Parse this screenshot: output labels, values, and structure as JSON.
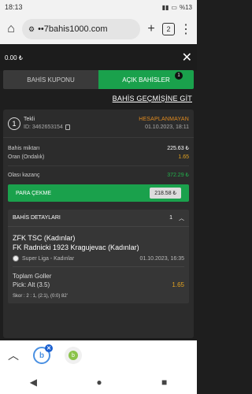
{
  "status": {
    "time": "18:13",
    "battery": "%13"
  },
  "browser": {
    "url": "••7bahis1000.com",
    "tab_count": "2"
  },
  "wallet": {
    "balance": "0.00 ₺"
  },
  "tabs": [
    {
      "label": "BAHİS KUPONU"
    },
    {
      "label": "AÇIK BAHİSLER",
      "badge": "1"
    }
  ],
  "history_link": "BAHİS GEÇMİŞİNE GİT",
  "bet": {
    "number": "1",
    "type": "Tekli",
    "id_label": "ID: 3462653154",
    "status": "HESAPLANMAYAN",
    "date": "01.10.2023, 18:11",
    "stake_label": "Bahis miktarı",
    "stake_value": "225.63 ₺",
    "odds_label": "Oran (Ondalık)",
    "odds_value": "1.65",
    "potential_label": "Olası kazanç",
    "potential_value": "372.29 ₺",
    "cashout_label": "PARA ÇEKME",
    "cashout_value": "218.58 ₺"
  },
  "details": {
    "title": "BAHİS DETAYLARI",
    "count": "1",
    "team1": "ZFK TSC (Kadınlar)",
    "team2": "FK Radnicki 1923 Kragujevac (Kadınlar)",
    "league": "Super Liga - Kadınlar",
    "match_date": "01.10.2023, 16:35",
    "market": "Toplam Goller",
    "pick": "Pick: Alt (3.5)",
    "pick_odds": "1.65",
    "score": "Skor : 2 : 1, (2:1), (0:0) 82'"
  }
}
